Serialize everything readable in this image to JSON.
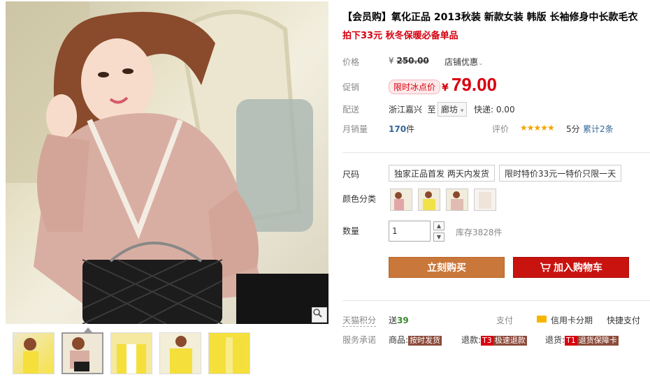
{
  "product": {
    "title": "【会员购】氧化正品 2013秋装 新款女装 韩版 长袖修身中长款毛衣",
    "subtitle": "拍下33元 秋冬保暖必备单品"
  },
  "price": {
    "label": "价格",
    "original_currency": "¥",
    "original_value": "250.00",
    "store_discount": "店铺优惠",
    "promo_label": "促销",
    "promo_tag": "限时冰点价",
    "current_currency": "¥",
    "current_value": "79.00"
  },
  "shipping": {
    "label": "配送",
    "from": "浙江嘉兴",
    "to_word": "至",
    "to": "廊坊",
    "fee": "快递: 0.00"
  },
  "sales": {
    "label": "月销量",
    "count": "170",
    "unit": "件",
    "rating_label": "评价",
    "stars": "★★★★★",
    "score": "5分",
    "reviews": "累计2条"
  },
  "options": {
    "size_label": "尺码",
    "sizes": [
      "独家正品首发 两天内发货",
      "限时特价33元一特价只限一天"
    ],
    "color_label": "颜色分类",
    "colors": [
      "#e9b8b4",
      "#f2e24a",
      "#e8c8c0",
      "#f4ece4"
    ],
    "qty_label": "数量",
    "qty_value": "1",
    "stock": "库存3828件"
  },
  "actions": {
    "buy": "立刻购买",
    "cart": "加入购物车"
  },
  "extras": {
    "points_label": "天猫积分",
    "points_prefix": "送",
    "points_value": "39",
    "pay_label": "支付",
    "installment": "信用卡分期",
    "quickpay": "快捷支付",
    "service_label": "服务承诺",
    "svc_goods_prefix": "商品:",
    "svc_goods_badge": "按时发货",
    "svc_refund_prefix": "退款:",
    "svc_refund_t": "T3",
    "svc_refund_badge": "极速退款",
    "svc_return_prefix": "退货:",
    "svc_return_t": "T1",
    "svc_return_badge": "退货保障卡"
  }
}
